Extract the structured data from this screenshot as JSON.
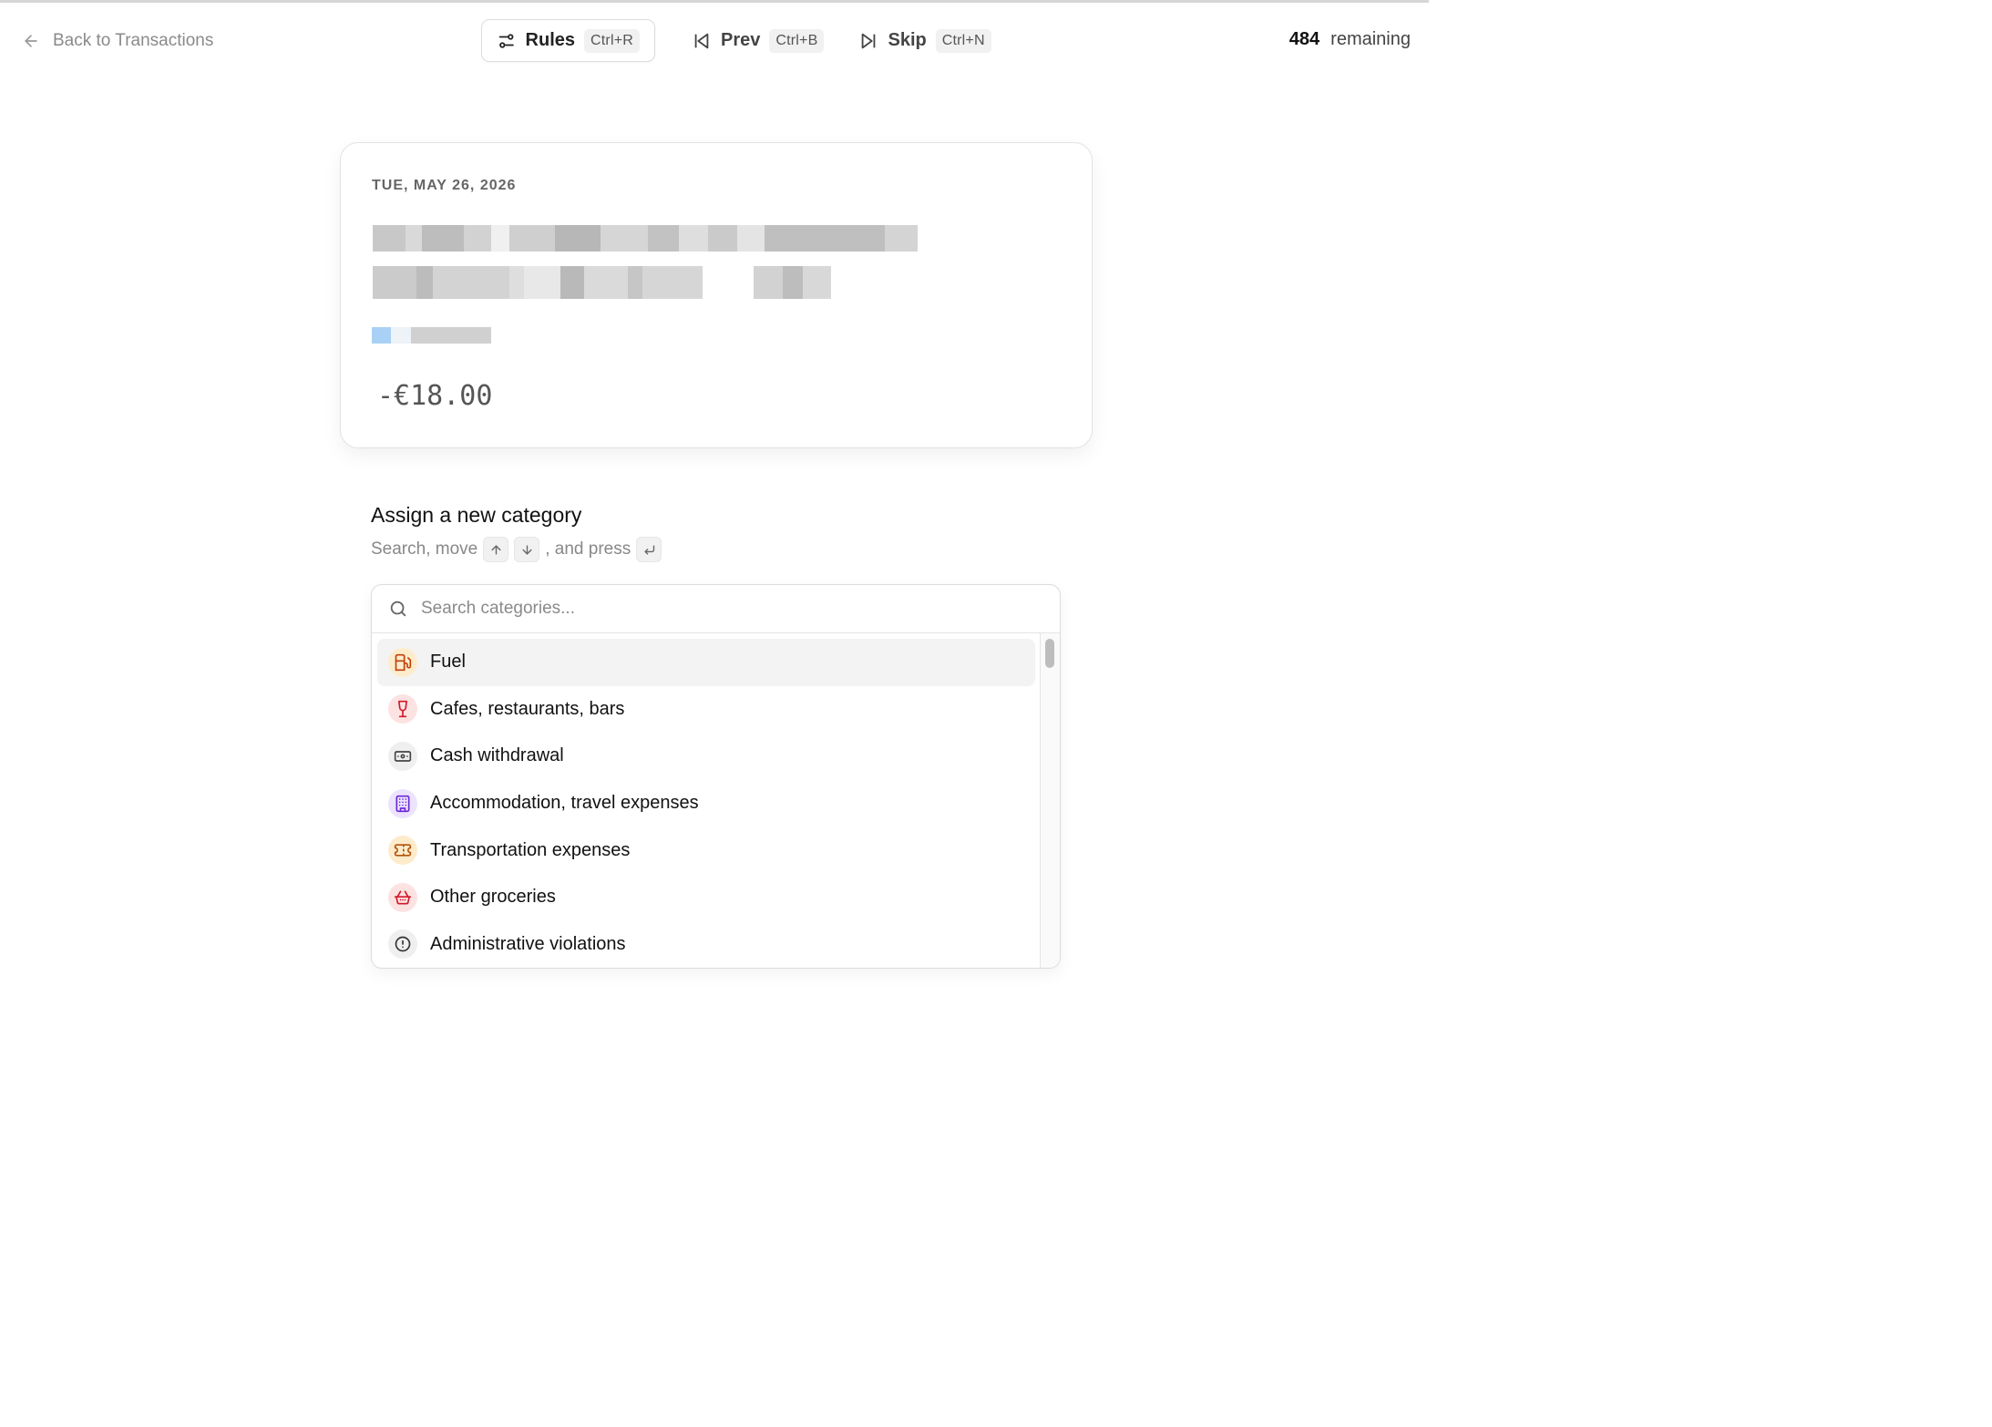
{
  "header": {
    "back_label": "Back to Transactions",
    "rules": {
      "label": "Rules",
      "shortcut": "Ctrl+R"
    },
    "prev": {
      "label": "Prev",
      "shortcut": "Ctrl+B"
    },
    "skip": {
      "label": "Skip",
      "shortcut": "Ctrl+N"
    },
    "remaining_count": "484",
    "remaining_label": "remaining"
  },
  "transaction": {
    "date": "TUE, MAY 26, 2026",
    "amount": "-€18.00"
  },
  "assign": {
    "title": "Assign a new category",
    "hint_prefix": "Search, move",
    "hint_middle": ", and press"
  },
  "search": {
    "placeholder": "Search categories...",
    "value": ""
  },
  "categories": [
    {
      "label": "Fuel",
      "icon": "fuel-pump-icon",
      "color": "#c2410c",
      "bg": "#fdeccc",
      "active": true
    },
    {
      "label": "Cafes, restaurants, bars",
      "icon": "wine-glass-icon",
      "color": "#d11a2a",
      "bg": "#fde2e2"
    },
    {
      "label": "Cash withdrawal",
      "icon": "banknote-icon",
      "color": "#444444",
      "bg": "#efefef"
    },
    {
      "label": "Accommodation, travel expenses",
      "icon": "building-icon",
      "color": "#6d28d9",
      "bg": "#ece4fd"
    },
    {
      "label": "Transportation expenses",
      "icon": "ticket-icon",
      "color": "#b45309",
      "bg": "#fdeccc"
    },
    {
      "label": "Other groceries",
      "icon": "shopping-basket-icon",
      "color": "#d11a2a",
      "bg": "#fde2e2"
    },
    {
      "label": "Administrative violations",
      "icon": "alert-circle-icon",
      "color": "#333333",
      "bg": "#efefef"
    }
  ],
  "scroll_position": 0
}
